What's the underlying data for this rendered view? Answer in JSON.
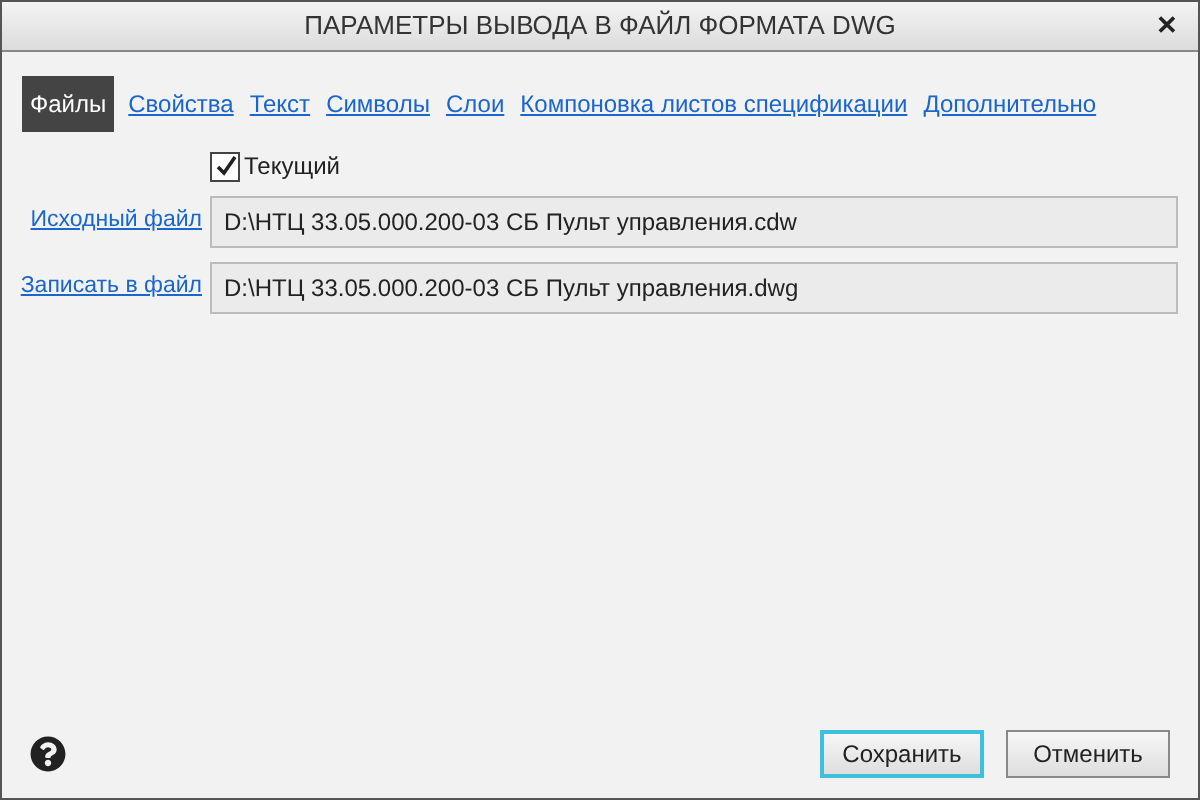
{
  "window": {
    "title": "ПАРАМЕТРЫ ВЫВОДА В ФАЙЛ ФОРМАТА DWG",
    "close": "✕"
  },
  "tabs": [
    {
      "label": "Файлы",
      "selected": true
    },
    {
      "label": "Свойства",
      "selected": false
    },
    {
      "label": "Текст",
      "selected": false
    },
    {
      "label": "Символы",
      "selected": false
    },
    {
      "label": "Слои",
      "selected": false
    },
    {
      "label": "Компоновка листов спецификации",
      "selected": false
    },
    {
      "label": "Дополнительно",
      "selected": false
    }
  ],
  "current": {
    "label": "Текущий",
    "checked": true
  },
  "fields": [
    {
      "label": "Исходный файл",
      "value": "D:\\НТЦ 33.05.000.200-03 СБ Пульт управления.cdw"
    },
    {
      "label": "Записать в файл",
      "value": "D:\\НТЦ 33.05.000.200-03 СБ Пульт управления.dwg"
    }
  ],
  "buttons": [
    {
      "label": "Сохранить",
      "selected": true
    },
    {
      "label": "Отменить",
      "selected": false
    }
  ]
}
